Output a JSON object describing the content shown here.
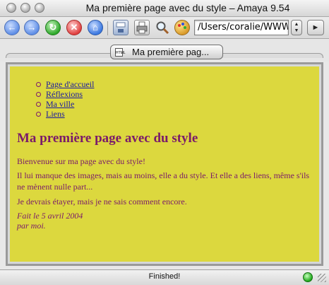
{
  "window": {
    "title": "Ma première page avec du style – Amaya 9.54"
  },
  "toolbar": {
    "url": "/Users/coralie/WWW",
    "buttons": [
      "back-icon",
      "forward-icon",
      "reload-icon",
      "stop-icon",
      "home-icon",
      "save-icon",
      "print-icon",
      "find-icon",
      "palette-icon"
    ]
  },
  "tab": {
    "label": "Ma première pag..."
  },
  "page": {
    "menu": [
      {
        "label": "Page d'accueil"
      },
      {
        "label": "Réflexions"
      },
      {
        "label": "Ma ville"
      },
      {
        "label": "Liens"
      }
    ],
    "heading": "Ma première page avec du style",
    "paragraphs": [
      "Bienvenue sur ma page avec du style!",
      "Il lui manque des images, mais au moins, elle a du style. Et elle a des liens, même s'ils ne mènent nulle part...",
      "Je devrais étayer, mais je ne sais comment encore."
    ],
    "signature": {
      "line1": "Fait le 5 avril 2004",
      "line2": "par moi."
    },
    "colors": {
      "background": "#dcd83e",
      "text": "#7a1a6a",
      "link": "#1a1aa0"
    }
  },
  "status": {
    "text": "Finished!"
  }
}
